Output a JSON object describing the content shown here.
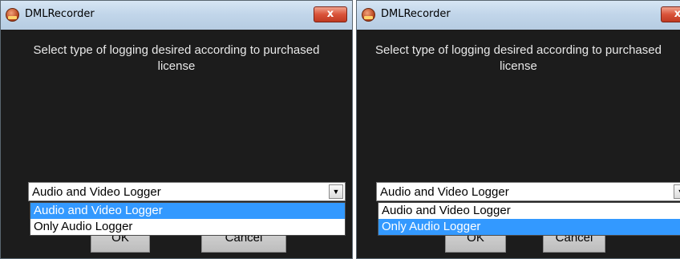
{
  "windows": [
    {
      "title": "DMLRecorder",
      "close_label": "x",
      "prompt": "Select type of logging desired according to purchased license",
      "select_value": "Audio and Video Logger",
      "select_arrow": "▼",
      "options": [
        "Audio and Video Logger",
        "Only Audio Logger"
      ],
      "highlighted_option": "Audio and Video Logger",
      "ok_label": "OK",
      "cancel_label": "Cancel"
    },
    {
      "title": "DMLRecorder",
      "close_label": "x",
      "prompt": "Select type of logging desired according to purchased license",
      "select_value": "Audio and Video Logger",
      "select_arrow": "▼",
      "options": [
        "Audio and Video Logger",
        "Only Audio Logger"
      ],
      "highlighted_option": "Only Audio Logger",
      "ok_label": "OK",
      "cancel_label": "Cancel"
    }
  ],
  "icons": {
    "app": "dml-app-icon",
    "close": "close-icon",
    "dropdown": "chevron-down-icon"
  },
  "colors": {
    "window_bg": "#1c1c1c",
    "titlebar": "#c2d6ea",
    "highlight": "#3399ff",
    "prompt_text": "#e8e8e8",
    "close_button": "#d9533a"
  }
}
